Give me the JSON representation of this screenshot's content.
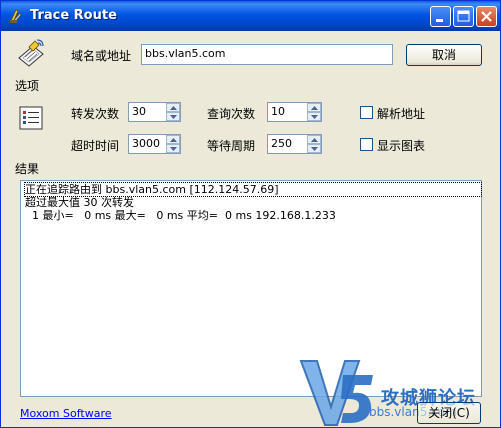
{
  "window": {
    "title": "Trace Route",
    "minimize_icon": "minimize-icon",
    "maximize_icon": "maximize-icon",
    "close_icon": "close-icon"
  },
  "host": {
    "label": "域名或地址",
    "value": "bbs.vlan5.com",
    "cancel_label": "取消"
  },
  "options": {
    "group_label": "选项",
    "hops_label": "转发次数",
    "hops_value": "30",
    "queries_label": "查询次数",
    "queries_value": "10",
    "resolve_label": "解析地址",
    "timeout_label": "超时时间",
    "timeout_value": "3000",
    "wait_label": "等待周期",
    "wait_value": "250",
    "graph_label": "显示图表"
  },
  "results": {
    "group_label": "结果",
    "lines": [
      "正在追踪路由到 bbs.vlan5.com [112.124.57.69]",
      "超过最大值 30 次转发",
      "  1 最小=   0 ms 最大=   0 ms 平均=  0 ms 192.168.1.233"
    ]
  },
  "footer": {
    "link": "Moxom Software",
    "close_label": "关闭(C)"
  },
  "watermark": {
    "brand": "攻城狮论坛",
    "url": "bbs.vlan5.com",
    "logo_text": "V5"
  },
  "colors": {
    "titlebar": "#0054e3",
    "face": "#ece9d8",
    "link": "#0000ff",
    "watermark": "#2a6fc4"
  }
}
